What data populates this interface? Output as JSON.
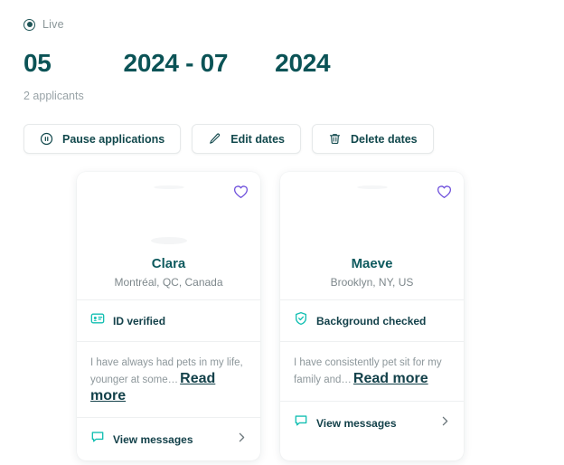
{
  "status": {
    "icon": "radio-filled-icon",
    "label": "Live"
  },
  "heading": {
    "start_day": "05",
    "range": "2024 - 07",
    "end_year": "2024",
    "full_text": "05 2024 - 07 2024",
    "color": "#0b5356"
  },
  "applicant_count": "2 applicants",
  "actions": [
    {
      "id": "pause-applications",
      "label": "Pause applications",
      "icon": "pause-circle-icon"
    },
    {
      "id": "edit-dates",
      "label": "Edit dates",
      "icon": "pencil-icon"
    },
    {
      "id": "delete-dates",
      "label": "Delete dates",
      "icon": "trash-icon"
    }
  ],
  "colors": {
    "teal_dark": "#0b5356",
    "teal_accent": "#13bfb2",
    "favorite_purple": "#6c4ddb",
    "muted_text": "#8d979b"
  },
  "cards": [
    {
      "name": "Clara",
      "location": "Montréal, QC, Canada",
      "favorite_icon": "heart-outline-icon",
      "verification": {
        "icon": "id-card-icon",
        "label": "ID verified"
      },
      "bio": "I have always had pets in my life, younger at some…",
      "read_more": "Read more",
      "messages": {
        "icon": "chat-bubble-icon",
        "label": "View messages",
        "chevron": "chevron-right-icon"
      }
    },
    {
      "name": "Maeve",
      "location": "Brooklyn, NY, US",
      "favorite_icon": "heart-outline-icon",
      "verification": {
        "icon": "shield-check-icon",
        "label": "Background checked"
      },
      "bio": "I have consistently pet sit for my family and…",
      "read_more": "Read more",
      "messages": {
        "icon": "chat-bubble-icon",
        "label": "View messages",
        "chevron": "chevron-right-icon"
      }
    }
  ]
}
